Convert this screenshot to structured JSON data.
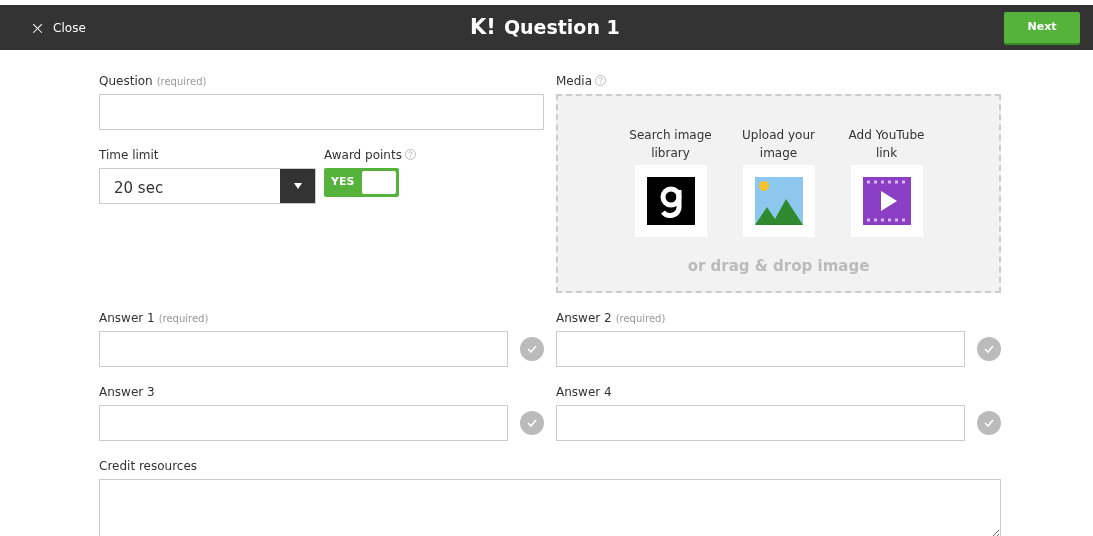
{
  "header": {
    "close_icon": "×",
    "close_label": "Close",
    "logo": "K!",
    "title": "Question 1",
    "next_button": "Next"
  },
  "question": {
    "label": "Question",
    "hint": "(required)"
  },
  "time_limit": {
    "label": "Time limit",
    "value": "20 sec"
  },
  "award_points": {
    "label": "Award points",
    "on": true,
    "toggle_text": "YES"
  },
  "media": {
    "label": "Media",
    "drop_text": "or drag & drop image",
    "options": [
      {
        "kind": "library",
        "label": "Search image library"
      },
      {
        "kind": "upload",
        "label": "Upload your image"
      },
      {
        "kind": "video",
        "label": "Add YouTube link"
      }
    ]
  },
  "answers": [
    {
      "label": "Answer 1",
      "hint": "(required)",
      "correct": false
    },
    {
      "label": "Answer 2",
      "hint": "(required)",
      "correct": false
    },
    {
      "label": "Answer 3",
      "correct": false
    },
    {
      "label": "Answer 4",
      "correct": false
    }
  ],
  "credit": {
    "label": "Credit resources"
  }
}
